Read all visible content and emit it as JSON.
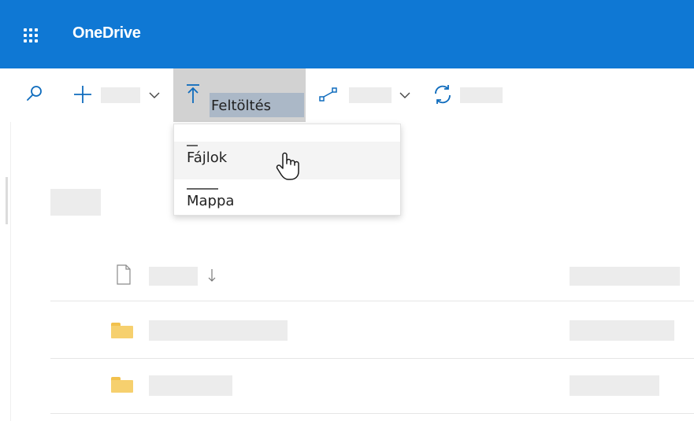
{
  "header": {
    "app_title": "OneDrive",
    "waffle_icon": "app-launcher-icon",
    "background": "#0f78d4"
  },
  "commandbar": {
    "icons": [
      "search-icon",
      "plus-icon",
      "chevron-down-icon",
      "upload-icon",
      "flow-icon",
      "sync-icon"
    ],
    "upload_label": "Feltöltés"
  },
  "upload_menu": {
    "items": [
      {
        "label": "Fájlok",
        "hovered": true
      },
      {
        "label": "Mappa",
        "hovered": false
      }
    ]
  },
  "file_list": {
    "header_icons": [
      "file-type-icon",
      "sort-arrow-down-icon"
    ],
    "rows": [
      {
        "type": "folder",
        "icon": "folder-icon"
      },
      {
        "type": "folder",
        "icon": "folder-icon"
      }
    ]
  }
}
